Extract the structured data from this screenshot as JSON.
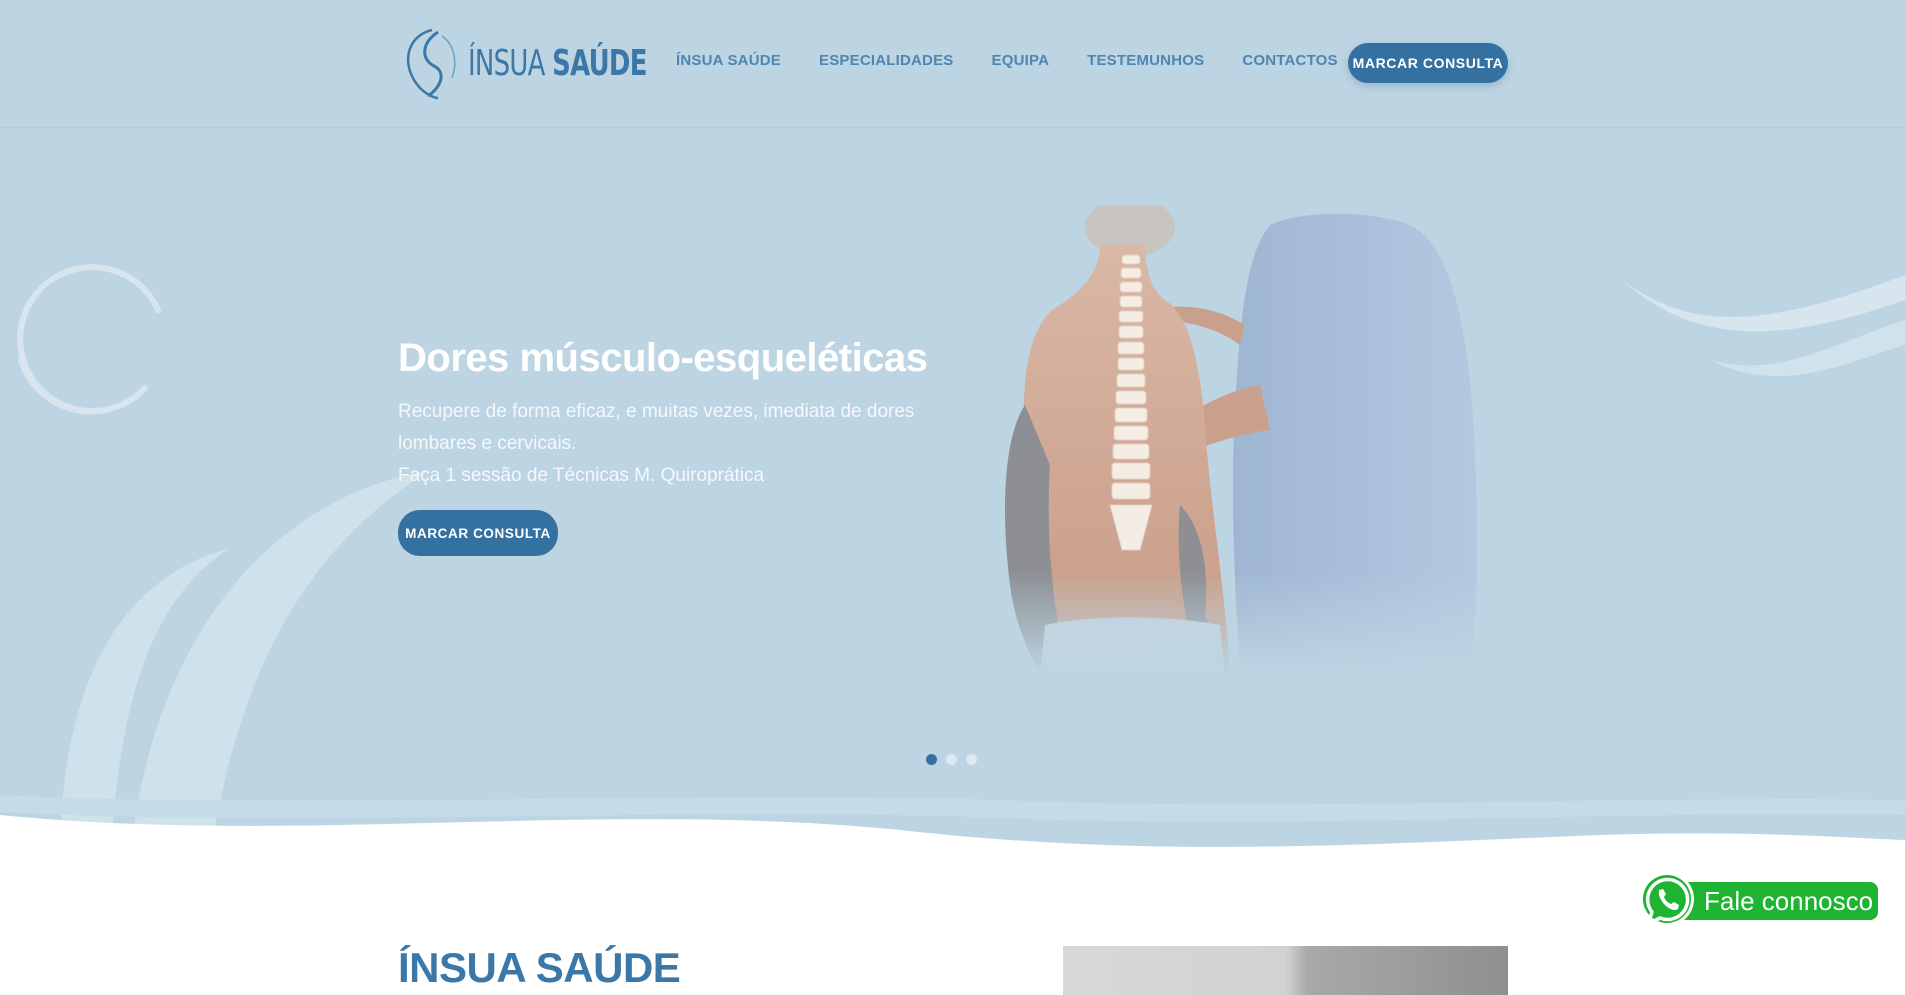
{
  "brand": {
    "name_light": "ÍNSUA",
    "name_bold": "SAÚDE",
    "colors": {
      "primary": "#3471a1",
      "link": "#4d86b2",
      "hero_bg": "#bdd5e2",
      "whatsapp": "#1fb332"
    }
  },
  "nav": {
    "items": [
      "ÍNSUA SAÚDE",
      "ESPECIALIDADES",
      "EQUIPA",
      "TESTEMUNHOS",
      "CONTACTOS"
    ],
    "cta": "MARCAR CONSULTA"
  },
  "hero": {
    "title": "Dores músculo-esqueléticas",
    "desc_line1": "Recupere de forma eficaz, e muitas vezes, imediata de dores",
    "desc_line2": "lombares e cervicais.",
    "desc_line3": "Faça 1 sessão de Técnicas M. Quiroprática",
    "cta": "MARCAR CONSULTA",
    "slides": 3,
    "active_slide": 1
  },
  "section": {
    "title": "ÍNSUA SAÚDE"
  },
  "whatsapp": {
    "label": "Fale connosco",
    "icon": "whatsapp-icon"
  }
}
